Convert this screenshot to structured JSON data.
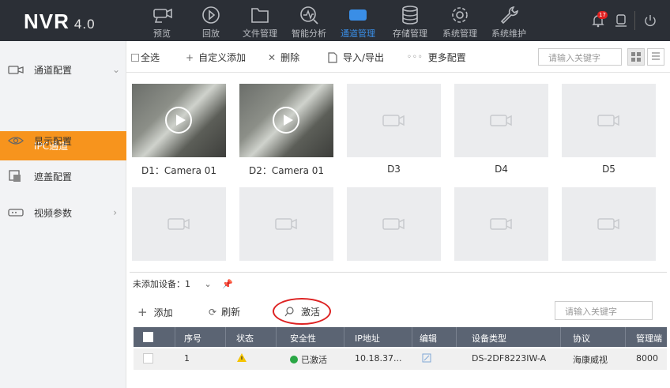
{
  "app": {
    "name": "NVR",
    "version": "4.0"
  },
  "nav": [
    {
      "label": "预览",
      "icon": "camera-icon"
    },
    {
      "label": "回放",
      "icon": "playback-icon"
    },
    {
      "label": "文件管理",
      "icon": "folder-icon"
    },
    {
      "label": "智能分析",
      "icon": "analysis-icon"
    },
    {
      "label": "通道管理",
      "icon": "channel-icon",
      "active": true
    },
    {
      "label": "存储管理",
      "icon": "storage-icon"
    },
    {
      "label": "系统管理",
      "icon": "gear-icon"
    },
    {
      "label": "系统维护",
      "icon": "wrench-icon"
    }
  ],
  "topright": {
    "alarm_count": "17"
  },
  "sidebar": {
    "items": [
      {
        "label": "通道配置",
        "icon": "channel-config-icon"
      },
      {
        "label": "显示配置",
        "icon": "eye-icon"
      },
      {
        "label": "遮盖配置",
        "icon": "mask-icon"
      },
      {
        "label": "视频参数",
        "icon": "video-param-icon"
      }
    ],
    "sub_active": "IPC通道"
  },
  "toolbar": {
    "select_all": "全选",
    "custom_add": "自定义添加",
    "delete": "删除",
    "import_export": "导入/导出",
    "more_config": "更多配置",
    "search_placeholder": "请输入关键字"
  },
  "channels": [
    {
      "label": "D1：Camera 01",
      "live": true
    },
    {
      "label": "D2：Camera 01",
      "live": true
    },
    {
      "label": "D3",
      "live": false
    },
    {
      "label": "D4",
      "live": false
    },
    {
      "label": "D5",
      "live": false
    },
    {
      "label": "",
      "live": false
    },
    {
      "label": "",
      "live": false
    },
    {
      "label": "",
      "live": false
    },
    {
      "label": "",
      "live": false
    },
    {
      "label": "",
      "live": false
    }
  ],
  "unadded": {
    "title": "未添加设备：",
    "count": "1",
    "add": "添加",
    "refresh": "刷新",
    "activate": "激活",
    "search_placeholder": "请输入关键字",
    "columns": [
      "序号",
      "状态",
      "安全性",
      "IP地址",
      "编辑",
      "设备类型",
      "协议",
      "管理端"
    ],
    "rows": [
      {
        "index": "1",
        "security": "已激活",
        "ip": "10.18.37...",
        "type": "DS-2DF8223IW-A",
        "protocol": "海康威视",
        "port": "8000"
      }
    ]
  },
  "colors": {
    "topbar": "#2b2f36",
    "accent": "#3a8ee6",
    "sidebar_active": "#f7941d",
    "table_header": "#5b6473",
    "highlight_circle": "#dd2222"
  }
}
